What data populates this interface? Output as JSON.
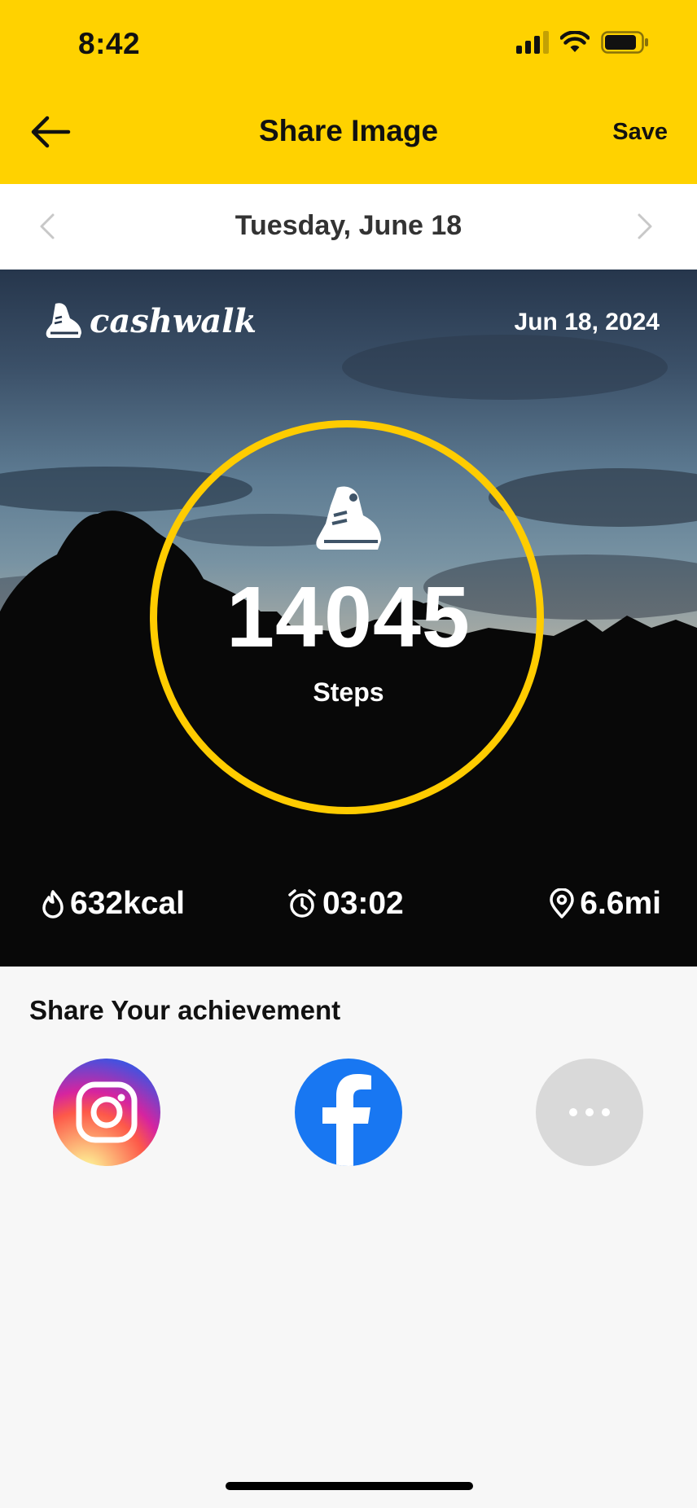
{
  "status_bar": {
    "time": "8:42"
  },
  "header": {
    "title": "Share Image",
    "save_label": "Save",
    "accent_color": "#ffd200"
  },
  "date_nav": {
    "date_label": "Tuesday, June 18"
  },
  "card": {
    "brand_name": "cashwalk",
    "date": "Jun 18, 2024",
    "steps_value": "14045",
    "steps_label": "Steps",
    "ring_color": "#ffcc00",
    "metrics": {
      "calories": "632kcal",
      "duration": "03:02",
      "distance": "6.6mi"
    }
  },
  "share": {
    "title": "Share Your achievement",
    "options": [
      {
        "name": "instagram",
        "icon": "instagram-icon"
      },
      {
        "name": "facebook",
        "icon": "facebook-icon",
        "color": "#1877f2"
      },
      {
        "name": "more",
        "icon": "more-dots-icon",
        "color": "#d9d9d9"
      }
    ]
  }
}
